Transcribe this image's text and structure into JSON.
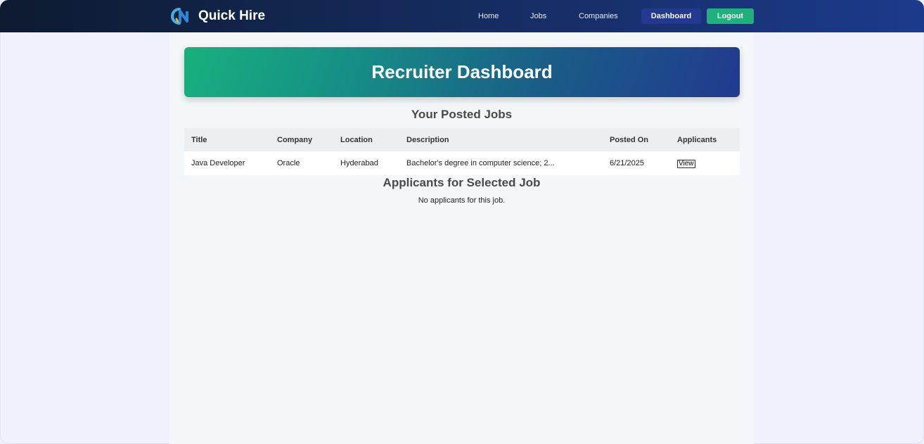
{
  "app": {
    "name": "Quick Hire"
  },
  "nav": {
    "links": [
      "Home",
      "Jobs",
      "Companies"
    ],
    "dashboard_label": "Dashboard",
    "logout_label": "Logout"
  },
  "hero": {
    "title": "Recruiter Dashboard"
  },
  "posted_jobs": {
    "heading": "Your Posted Jobs",
    "columns": [
      "Title",
      "Company",
      "Location",
      "Description",
      "Posted On",
      "Applicants"
    ],
    "rows": [
      {
        "title": "Java Developer",
        "company": "Oracle",
        "location": "Hyderabad",
        "description": "Bachelor's degree in computer science; 2...",
        "posted_on": "6/21/2025",
        "action_label": "View"
      }
    ]
  },
  "applicants": {
    "heading": "Applicants for Selected Job",
    "empty_message": "No applicants for this job."
  },
  "colors": {
    "nav_start": "#0d1a30",
    "nav_end": "#1c3a8c",
    "accent_green": "#1fb17c",
    "accent_blue": "#23398f"
  },
  "icons": {
    "logo": "quick-hire-logo-icon"
  }
}
